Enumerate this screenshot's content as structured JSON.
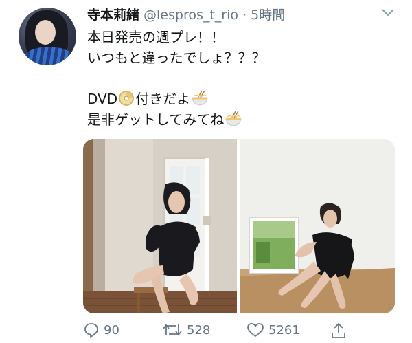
{
  "tweet": {
    "display_name": "寺本莉緒",
    "handle_time": "@lespros_t_rio · 5時間",
    "lines": {
      "l1": "本日発売の週プレ！！",
      "l2": "いつもと違ったでしょ？？？",
      "l4a": "DVD",
      "l4b": "付きだよ",
      "l5": "是非ゲットしてみてね"
    }
  },
  "icons": [
    "avatar",
    "chevron-down-icon",
    "dvd-disc-icon",
    "noodle-bowl-icon",
    "reply-icon",
    "retweet-icon",
    "like-icon",
    "share-icon"
  ],
  "stats": {
    "replies": "90",
    "retweets": "528",
    "likes": "5261"
  },
  "colors": {
    "text": "#14171a",
    "muted": "#657786"
  }
}
